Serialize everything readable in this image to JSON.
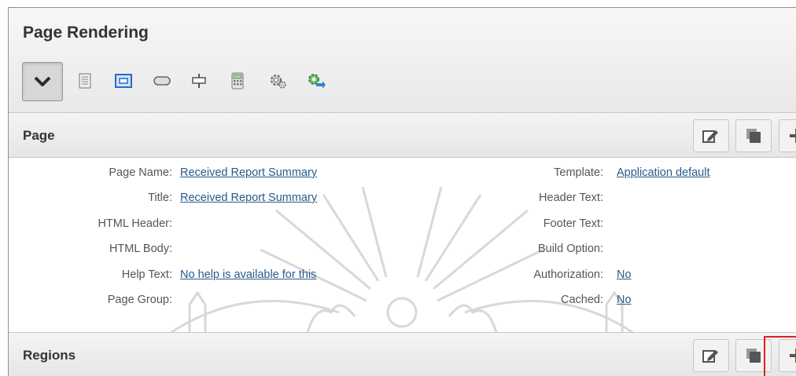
{
  "panel": {
    "title": "Page Rendering",
    "toolbar_icons": [
      "collapse-chevron-icon",
      "page-icon",
      "region-icon",
      "button-icon",
      "item-icon",
      "computation-icon",
      "process-icon",
      "branch-icon"
    ]
  },
  "page_section": {
    "title": "Page",
    "actions": [
      "edit-icon",
      "copy-icon",
      "add-icon"
    ],
    "left_fields": [
      {
        "label": "Page Name:",
        "value": "Received Report Summary"
      },
      {
        "label": "Title:",
        "value": "Received Report Summary"
      },
      {
        "label": "HTML Header:",
        "value": ""
      },
      {
        "label": "HTML Body:",
        "value": ""
      },
      {
        "label": "Help Text:",
        "value": "No help is available for this"
      },
      {
        "label": "Page Group:",
        "value": ""
      }
    ],
    "right_fields": [
      {
        "label": "Template:",
        "value": "Application default"
      },
      {
        "label": "Header Text:",
        "value": ""
      },
      {
        "label": "Footer Text:",
        "value": ""
      },
      {
        "label": "Build Option:",
        "value": ""
      },
      {
        "label": "Authorization:",
        "value": "No"
      },
      {
        "label": "Cached:",
        "value": "No"
      }
    ]
  },
  "regions_section": {
    "title": "Regions",
    "actions": [
      "edit-icon",
      "copy-icon",
      "add-icon"
    ]
  },
  "colors": {
    "link": "#2a5a8a",
    "highlight": "#e02020"
  }
}
